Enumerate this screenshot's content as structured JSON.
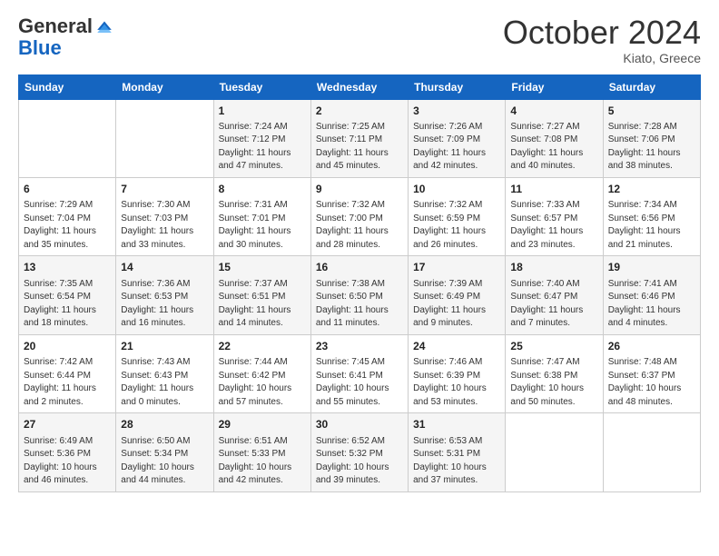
{
  "header": {
    "logo_general": "General",
    "logo_blue": "Blue",
    "month_title": "October 2024",
    "location": "Kiato, Greece"
  },
  "days_of_week": [
    "Sunday",
    "Monday",
    "Tuesday",
    "Wednesday",
    "Thursday",
    "Friday",
    "Saturday"
  ],
  "weeks": [
    [
      {
        "day": "",
        "content": ""
      },
      {
        "day": "",
        "content": ""
      },
      {
        "day": "1",
        "content": "Sunrise: 7:24 AM\nSunset: 7:12 PM\nDaylight: 11 hours and 47 minutes."
      },
      {
        "day": "2",
        "content": "Sunrise: 7:25 AM\nSunset: 7:11 PM\nDaylight: 11 hours and 45 minutes."
      },
      {
        "day": "3",
        "content": "Sunrise: 7:26 AM\nSunset: 7:09 PM\nDaylight: 11 hours and 42 minutes."
      },
      {
        "day": "4",
        "content": "Sunrise: 7:27 AM\nSunset: 7:08 PM\nDaylight: 11 hours and 40 minutes."
      },
      {
        "day": "5",
        "content": "Sunrise: 7:28 AM\nSunset: 7:06 PM\nDaylight: 11 hours and 38 minutes."
      }
    ],
    [
      {
        "day": "6",
        "content": "Sunrise: 7:29 AM\nSunset: 7:04 PM\nDaylight: 11 hours and 35 minutes."
      },
      {
        "day": "7",
        "content": "Sunrise: 7:30 AM\nSunset: 7:03 PM\nDaylight: 11 hours and 33 minutes."
      },
      {
        "day": "8",
        "content": "Sunrise: 7:31 AM\nSunset: 7:01 PM\nDaylight: 11 hours and 30 minutes."
      },
      {
        "day": "9",
        "content": "Sunrise: 7:32 AM\nSunset: 7:00 PM\nDaylight: 11 hours and 28 minutes."
      },
      {
        "day": "10",
        "content": "Sunrise: 7:32 AM\nSunset: 6:59 PM\nDaylight: 11 hours and 26 minutes."
      },
      {
        "day": "11",
        "content": "Sunrise: 7:33 AM\nSunset: 6:57 PM\nDaylight: 11 hours and 23 minutes."
      },
      {
        "day": "12",
        "content": "Sunrise: 7:34 AM\nSunset: 6:56 PM\nDaylight: 11 hours and 21 minutes."
      }
    ],
    [
      {
        "day": "13",
        "content": "Sunrise: 7:35 AM\nSunset: 6:54 PM\nDaylight: 11 hours and 18 minutes."
      },
      {
        "day": "14",
        "content": "Sunrise: 7:36 AM\nSunset: 6:53 PM\nDaylight: 11 hours and 16 minutes."
      },
      {
        "day": "15",
        "content": "Sunrise: 7:37 AM\nSunset: 6:51 PM\nDaylight: 11 hours and 14 minutes."
      },
      {
        "day": "16",
        "content": "Sunrise: 7:38 AM\nSunset: 6:50 PM\nDaylight: 11 hours and 11 minutes."
      },
      {
        "day": "17",
        "content": "Sunrise: 7:39 AM\nSunset: 6:49 PM\nDaylight: 11 hours and 9 minutes."
      },
      {
        "day": "18",
        "content": "Sunrise: 7:40 AM\nSunset: 6:47 PM\nDaylight: 11 hours and 7 minutes."
      },
      {
        "day": "19",
        "content": "Sunrise: 7:41 AM\nSunset: 6:46 PM\nDaylight: 11 hours and 4 minutes."
      }
    ],
    [
      {
        "day": "20",
        "content": "Sunrise: 7:42 AM\nSunset: 6:44 PM\nDaylight: 11 hours and 2 minutes."
      },
      {
        "day": "21",
        "content": "Sunrise: 7:43 AM\nSunset: 6:43 PM\nDaylight: 11 hours and 0 minutes."
      },
      {
        "day": "22",
        "content": "Sunrise: 7:44 AM\nSunset: 6:42 PM\nDaylight: 10 hours and 57 minutes."
      },
      {
        "day": "23",
        "content": "Sunrise: 7:45 AM\nSunset: 6:41 PM\nDaylight: 10 hours and 55 minutes."
      },
      {
        "day": "24",
        "content": "Sunrise: 7:46 AM\nSunset: 6:39 PM\nDaylight: 10 hours and 53 minutes."
      },
      {
        "day": "25",
        "content": "Sunrise: 7:47 AM\nSunset: 6:38 PM\nDaylight: 10 hours and 50 minutes."
      },
      {
        "day": "26",
        "content": "Sunrise: 7:48 AM\nSunset: 6:37 PM\nDaylight: 10 hours and 48 minutes."
      }
    ],
    [
      {
        "day": "27",
        "content": "Sunrise: 6:49 AM\nSunset: 5:36 PM\nDaylight: 10 hours and 46 minutes."
      },
      {
        "day": "28",
        "content": "Sunrise: 6:50 AM\nSunset: 5:34 PM\nDaylight: 10 hours and 44 minutes."
      },
      {
        "day": "29",
        "content": "Sunrise: 6:51 AM\nSunset: 5:33 PM\nDaylight: 10 hours and 42 minutes."
      },
      {
        "day": "30",
        "content": "Sunrise: 6:52 AM\nSunset: 5:32 PM\nDaylight: 10 hours and 39 minutes."
      },
      {
        "day": "31",
        "content": "Sunrise: 6:53 AM\nSunset: 5:31 PM\nDaylight: 10 hours and 37 minutes."
      },
      {
        "day": "",
        "content": ""
      },
      {
        "day": "",
        "content": ""
      }
    ]
  ]
}
